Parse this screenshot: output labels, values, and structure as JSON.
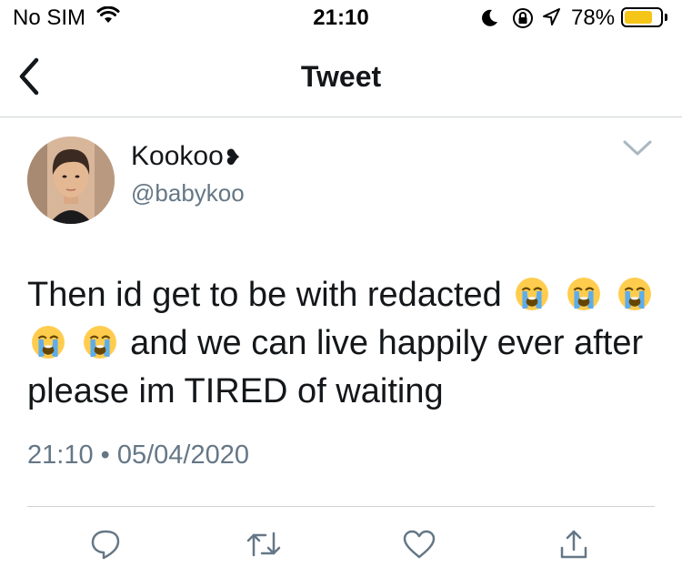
{
  "status_bar": {
    "carrier": "No SIM",
    "time": "21:10",
    "battery_percent": "78%",
    "battery_level": 0.78,
    "icons": [
      "wifi-icon",
      "moon-icon",
      "orientation-lock-icon",
      "location-icon",
      "battery-icon"
    ]
  },
  "nav": {
    "title": "Tweet",
    "back_icon": "chevron-left-icon"
  },
  "tweet": {
    "display_name": "Kookoo",
    "name_emoji": "❥",
    "handle": "@babykoo",
    "text_part1": "Then id get to be with redacted",
    "text_part2": "and we can live happily ever after please im TIRED of waiting",
    "emoji": "loudly-crying-face",
    "timestamp": "21:10 • 05/04/2020"
  },
  "actions": {
    "icons": [
      "reply-icon",
      "retweet-icon",
      "like-icon",
      "share-icon"
    ]
  },
  "colors": {
    "text": "#14171a",
    "secondary": "#657786",
    "divider": "#cfd3d6",
    "battery": "#f5c518"
  }
}
